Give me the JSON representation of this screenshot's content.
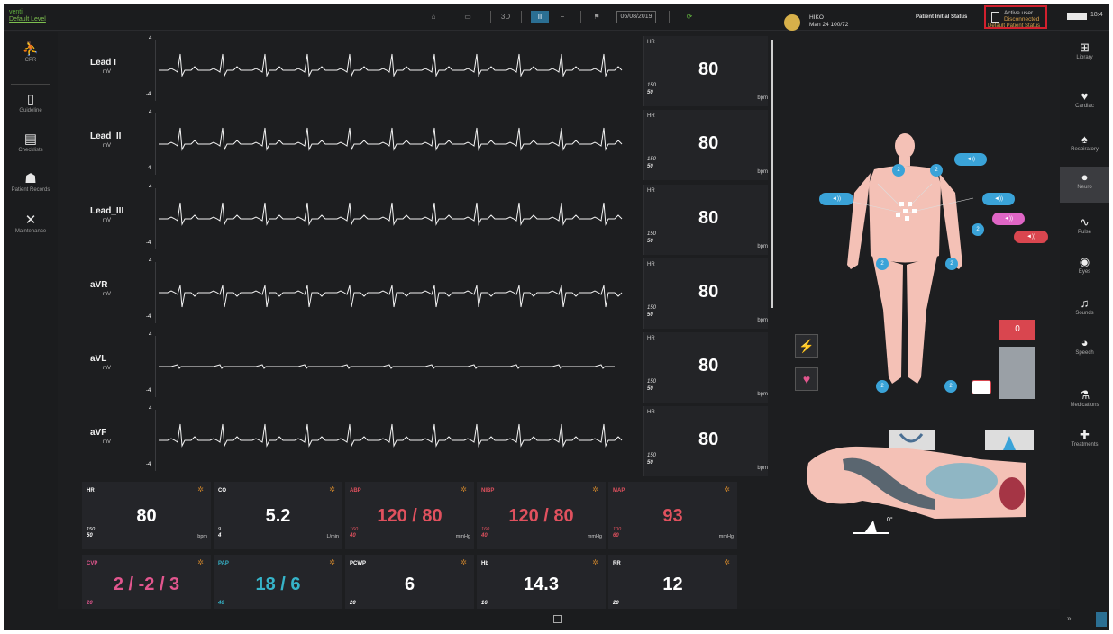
{
  "app": {
    "logo_line1": "ventil",
    "logo_line2": "Default Level"
  },
  "toolbar": {
    "button_3d": "3D",
    "button_pause": "II",
    "date": "06/08/2019"
  },
  "status": {
    "title": "Active user",
    "subtitle": "Disconnected"
  },
  "battery_text": "18:4",
  "left_nav": [
    {
      "label": "CPR",
      "icon": "cpr-icon",
      "glyph": "⛹"
    },
    {
      "label": "Guideline",
      "icon": "tablet-icon",
      "glyph": "▯"
    },
    {
      "label": "Checklists",
      "icon": "checklist-icon",
      "glyph": "▤"
    },
    {
      "label": "Patient Records",
      "icon": "patient-record-icon",
      "glyph": "☗"
    },
    {
      "label": "Maintenance",
      "icon": "tools-icon",
      "glyph": "✕"
    }
  ],
  "right_nav": [
    {
      "label": "Library",
      "icon": "library-icon",
      "glyph": "⊞"
    },
    {
      "label": "Cardiac",
      "icon": "heart-icon",
      "glyph": "♥"
    },
    {
      "label": "Respiratory",
      "icon": "lungs-icon",
      "glyph": "♠"
    },
    {
      "label": "Neuro",
      "icon": "brain-icon",
      "glyph": "●"
    },
    {
      "label": "Pulse",
      "icon": "pulse-icon",
      "glyph": "∿"
    },
    {
      "label": "Eyes",
      "icon": "eye-icon",
      "glyph": "◉"
    },
    {
      "label": "Sounds",
      "icon": "stethoscope-icon",
      "glyph": "♫"
    },
    {
      "label": "Speech",
      "icon": "speech-icon",
      "glyph": "◕"
    },
    {
      "label": "Medications",
      "icon": "medications-icon",
      "glyph": "⚗"
    },
    {
      "label": "Treatments",
      "icon": "treatments-icon",
      "glyph": "✚"
    }
  ],
  "leads": [
    {
      "name": "Lead I",
      "unit": "mV",
      "scale_top": "4",
      "scale_bottom": "-4",
      "hr_title": "HR",
      "hr_value": "80",
      "hr_high": "150",
      "hr_low": "50",
      "hr_unit": "bpm"
    },
    {
      "name": "Lead_II",
      "unit": "mV",
      "scale_top": "4",
      "scale_bottom": "-4",
      "hr_title": "HR",
      "hr_value": "80",
      "hr_high": "150",
      "hr_low": "50",
      "hr_unit": "bpm"
    },
    {
      "name": "Lead_III",
      "unit": "mV",
      "scale_top": "4",
      "scale_bottom": "-4",
      "hr_title": "HR",
      "hr_value": "80",
      "hr_high": "150",
      "hr_low": "50",
      "hr_unit": "bpm"
    },
    {
      "name": "aVR",
      "unit": "mV",
      "scale_top": "4",
      "scale_bottom": "-4",
      "hr_title": "HR",
      "hr_value": "80",
      "hr_high": "150",
      "hr_low": "50",
      "hr_unit": "bpm"
    },
    {
      "name": "aVL",
      "unit": "mV",
      "scale_top": "4",
      "scale_bottom": "-4",
      "hr_title": "HR",
      "hr_value": "80",
      "hr_high": "150",
      "hr_low": "50",
      "hr_unit": "bpm"
    },
    {
      "name": "aVF",
      "unit": "mV",
      "scale_top": "4",
      "scale_bottom": "-4",
      "hr_title": "HR",
      "hr_value": "80",
      "hr_high": "150",
      "hr_low": "50",
      "hr_unit": "bpm"
    }
  ],
  "vitals_row1": [
    {
      "name": "HR",
      "value": "80",
      "high": "150",
      "low": "50",
      "unit": "bpm",
      "color": "white"
    },
    {
      "name": "CO",
      "value": "5.2",
      "high": "9",
      "low": "4",
      "unit": "L/min",
      "color": "white"
    },
    {
      "name": "ABP",
      "value": "120 / 80",
      "high": "160",
      "low": "40",
      "unit": "mmHg",
      "color": "red"
    },
    {
      "name": "NIBP",
      "value": "120 / 80",
      "high": "160",
      "low": "40",
      "unit": "mmHg",
      "color": "red"
    },
    {
      "name": "MAP",
      "value": "93",
      "high": "100",
      "low": "60",
      "unit": "mmHg",
      "color": "red"
    }
  ],
  "vitals_row2": [
    {
      "name": "CVP",
      "value": "2 / -2 / 3",
      "low": "20",
      "color": "pink"
    },
    {
      "name": "PAP",
      "value": "18 / 6",
      "low": "40",
      "color": "cyan"
    },
    {
      "name": "PCWP",
      "value": "6",
      "low": "20",
      "color": "white"
    },
    {
      "name": "Hb",
      "value": "14.3",
      "low": "16",
      "color": "white"
    },
    {
      "name": "RR",
      "value": "12",
      "low": "20",
      "color": "white"
    }
  ],
  "patient": {
    "name": "HIKO",
    "info": "Man 24 100/72",
    "status_label": "Patient Initial Status",
    "status_value": "Default Patient Status",
    "meter_value": "0",
    "bed_angle": "0°"
  }
}
